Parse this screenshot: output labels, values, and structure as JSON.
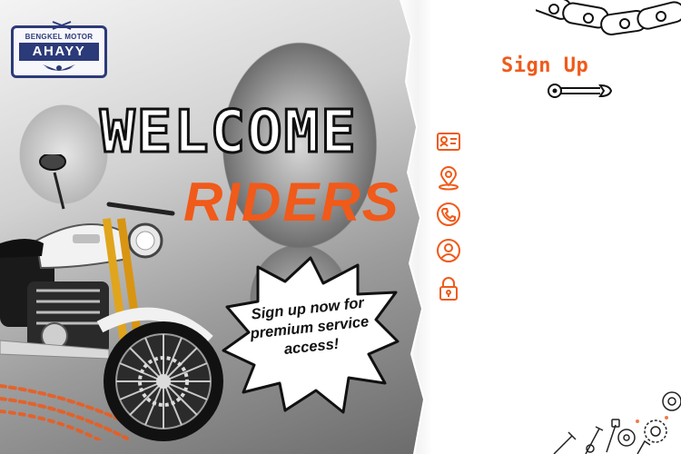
{
  "brand": {
    "top_text": "BENGKEL MOTOR",
    "name": "AHAYY"
  },
  "hero": {
    "welcome": "WELCOME",
    "riders": "RIDERS",
    "bubble_lines": [
      "Sign up now for",
      "premium service",
      "access!"
    ]
  },
  "form": {
    "title": "Sign Up",
    "fields": [
      {
        "icon": "id-card-icon"
      },
      {
        "icon": "location-pin-icon"
      },
      {
        "icon": "phone-icon"
      },
      {
        "icon": "user-icon"
      },
      {
        "icon": "lock-icon"
      }
    ]
  },
  "colors": {
    "accent": "#f05a1a",
    "brand_navy": "#2b3a78",
    "text_dark": "#111111"
  }
}
